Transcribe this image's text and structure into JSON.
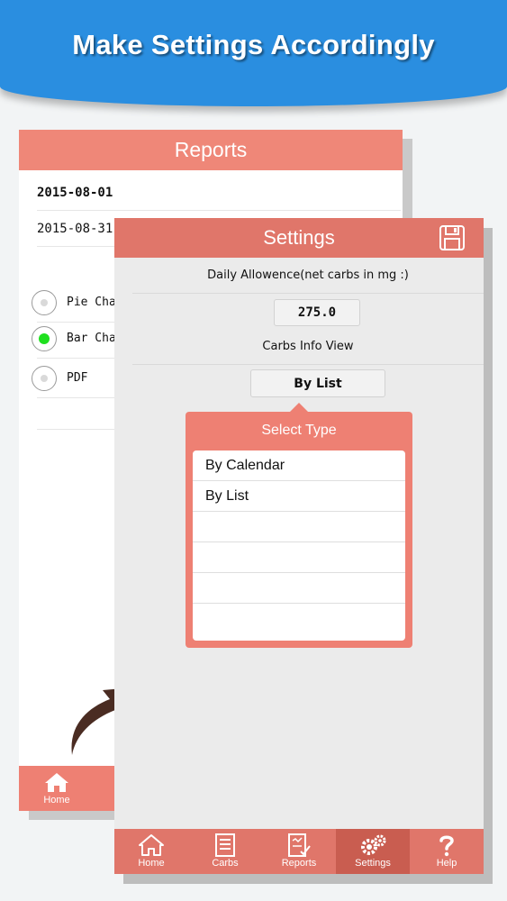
{
  "banner": {
    "title": "Make Settings Accordingly"
  },
  "reports": {
    "title": "Reports",
    "start_date": "2015-08-01",
    "end_date": "2015-08-31",
    "options": [
      {
        "label": "Pie Char",
        "selected": false
      },
      {
        "label": "Bar Char",
        "selected": true
      },
      {
        "label": "PDF",
        "selected": false
      }
    ],
    "footer": {
      "home_label": "Home"
    }
  },
  "settings": {
    "title": "Settings",
    "daily_label": "Daily Allowence(net carbs in mg :)",
    "daily_value": "275.0",
    "carbs_view_label": "Carbs Info View",
    "carbs_view_value": "By List",
    "popup": {
      "title": "Select Type",
      "items": [
        "By Calendar",
        "By List"
      ]
    },
    "tabs": [
      {
        "label": "Home",
        "icon": "home-icon"
      },
      {
        "label": "Carbs",
        "icon": "document-icon"
      },
      {
        "label": "Reports",
        "icon": "report-icon"
      },
      {
        "label": "Settings",
        "icon": "gears-icon",
        "active": true
      },
      {
        "label": "Help",
        "icon": "question-icon"
      }
    ]
  },
  "colors": {
    "banner": "#2a8ee0",
    "reports_header": "#ef8778",
    "settings_header": "#e0766a",
    "active_tab": "#c95d50",
    "radio_selected": "#1fe01f"
  }
}
